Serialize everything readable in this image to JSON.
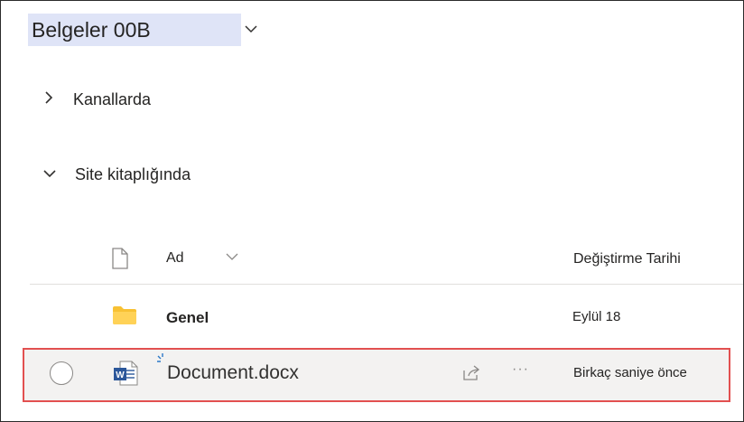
{
  "library": {
    "title": "Belgeler 00B"
  },
  "sections": {
    "channels_label": "Kanallarda",
    "site_library_label": "Site kitaplığında"
  },
  "columns": {
    "name_label": "Ad",
    "modified_label": "Değiştirme Tarihi"
  },
  "rows": [
    {
      "name": "Genel",
      "modified": "Eylül 18",
      "type": "folder"
    },
    {
      "name": "Document.docx",
      "modified": "Birkaç saniye önce",
      "type": "word",
      "more": "···"
    }
  ],
  "colors": {
    "title_highlight": "#dfe4f7",
    "selection_outline": "#e25050",
    "folder": "#f8c133",
    "word": "#2b579a"
  },
  "icons": [
    "chevron-down-icon",
    "chevron-right-icon",
    "file-icon",
    "folder-icon",
    "word-icon",
    "share-icon",
    "more-icon"
  ]
}
